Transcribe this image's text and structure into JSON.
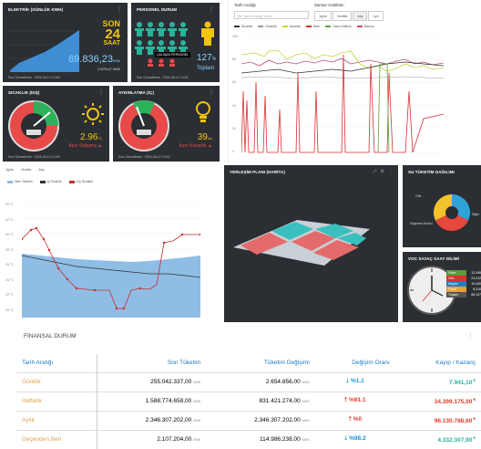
{
  "w1": {
    "title": "ELEKTRİK (GÜNLÜK KWH)",
    "big_num": "SON",
    "big2": "24",
    "big3": "SAAT",
    "value": "69.836,23",
    "unit": "kWh",
    "sub": "2.575,67 kWh",
    "foot": "Son Güncelleme : 2024-06-12 13:45"
  },
  "w2": {
    "title": "PERSONEL DURUM",
    "label": "ÇALIŞAN PERSONEL",
    "pct": "127",
    "pct_unit": "%",
    "sub": "Toplam",
    "foot": "Son Güncelleme : 2024-06-12 13:45"
  },
  "w3": {
    "title": "SICAKLIK (DIŞ)",
    "value": "2.96",
    "unit": "°C",
    "sub": "Aşırı Soğuma",
    "foot": "Son Güncelleme : 2024-06-12 13:45"
  },
  "w4": {
    "title": "AYDINLATMA (İÇ)",
    "value": "39",
    "unit": "lux",
    "sub": "Aşırı Karanlık",
    "foot": "Son Güncelleme : 2024-06-12 13:45"
  },
  "trend": {
    "date_label": "Tarih Aralığı",
    "date_placeholder": "Bir Tarih Aralığı Seçin",
    "zoom_label": "Zaman Aralıkları",
    "zoom_options": [
      "1gün",
      "1hafta",
      "1ay",
      "1yıl"
    ],
    "legend": [
      "Sıcaklık",
      "Sıcaklık",
      "Aydınlık",
      "Nem",
      "Hava Kalitesi",
      "Basınç"
    ],
    "legend_colors": [
      "#333333",
      "#999999",
      "#c8d33a",
      "#d93030",
      "#6aa03d",
      "#c24a7a"
    ],
    "y_ticks": [
      "100",
      "80",
      "60",
      "40",
      "20",
      "0"
    ]
  },
  "line": {
    "tabs": [
      "1gün",
      "1hafta",
      "1ay"
    ],
    "legend": [
      "Nem Tabanlı",
      "İç Sıcaklık",
      "Dış Sıcaklık"
    ],
    "legend_colors": [
      "#8fbde6",
      "#333333",
      "#cc2b2b"
    ],
    "y_ticks": [
      "34 °C",
      "32 °C",
      "30 °C",
      "28 °C",
      "26 °C",
      "24 °C",
      "22 °C",
      "20 °C"
    ]
  },
  "map": {
    "title": "YERLEŞİM PLANI (HARİTA)"
  },
  "pie": {
    "title": "SU TÜKETİM DAĞILIMI",
    "labels": [
      "Ofis",
      "Soğutma Kulesi",
      "Diğer"
    ],
    "colors": [
      "#2fa3d8",
      "#e8473d",
      "#f4c22b"
    ],
    "values": [
      32,
      36,
      32
    ]
  },
  "clock": {
    "title": "VOC SAYAÇ SAAT DİLİMİ",
    "rows": [
      {
        "label": "Gece",
        "value": "12,345"
      },
      {
        "label": "Gün",
        "value": "22,012"
      },
      {
        "label": "Akşam",
        "value": "15,440"
      },
      {
        "label": "Puant",
        "value": "8,310"
      },
      {
        "label": "Toplam",
        "value": "58,107"
      }
    ],
    "row_colors": [
      "#5b9a3a",
      "#d93030",
      "#2b7bb9",
      "#e8a13a",
      "#555555"
    ]
  },
  "finance": {
    "title": "FİNANSAL DURUM",
    "headers": [
      "Tarih Aralığı",
      "Son Tüketim",
      "Tüketim Değişimi",
      "Değişim Oranı",
      "Kayıp / Kazanç"
    ],
    "rows": [
      {
        "range": "Günlük",
        "last": "255.042.337,00",
        "last_unit": "kWh",
        "change": "2.654.856,00",
        "change_unit": "kWh",
        "rate": "%1.1",
        "dir": "down",
        "gain": "7.941,10",
        "gain_color": "#2bb39a"
      },
      {
        "range": "Haftalık",
        "last": "1.588.774.658,00",
        "last_unit": "kWh",
        "change": "831.421.274,00",
        "change_unit": "kWh",
        "rate": "%91.1",
        "dir": "up",
        "gain": "34.399.175,00",
        "gain_color": "#e23b2a"
      },
      {
        "range": "Aylık",
        "last": "2.346.307.202,00",
        "last_unit": "kWh",
        "change": "2.346.307.202,00",
        "change_unit": "kWh",
        "rate": "%0",
        "dir": "up",
        "gain": "96.130.788,60",
        "gain_color": "#e23b2a"
      },
      {
        "range": "Geçenden Beri",
        "last": "2.107.204,00",
        "last_unit": "kWh",
        "change": "114.986.238,00",
        "change_unit": "kWh",
        "rate": "%98.2",
        "dir": "down",
        "gain": "4.332.307,90",
        "gain_color": "#2bb39a"
      }
    ],
    "currency": "₺"
  }
}
